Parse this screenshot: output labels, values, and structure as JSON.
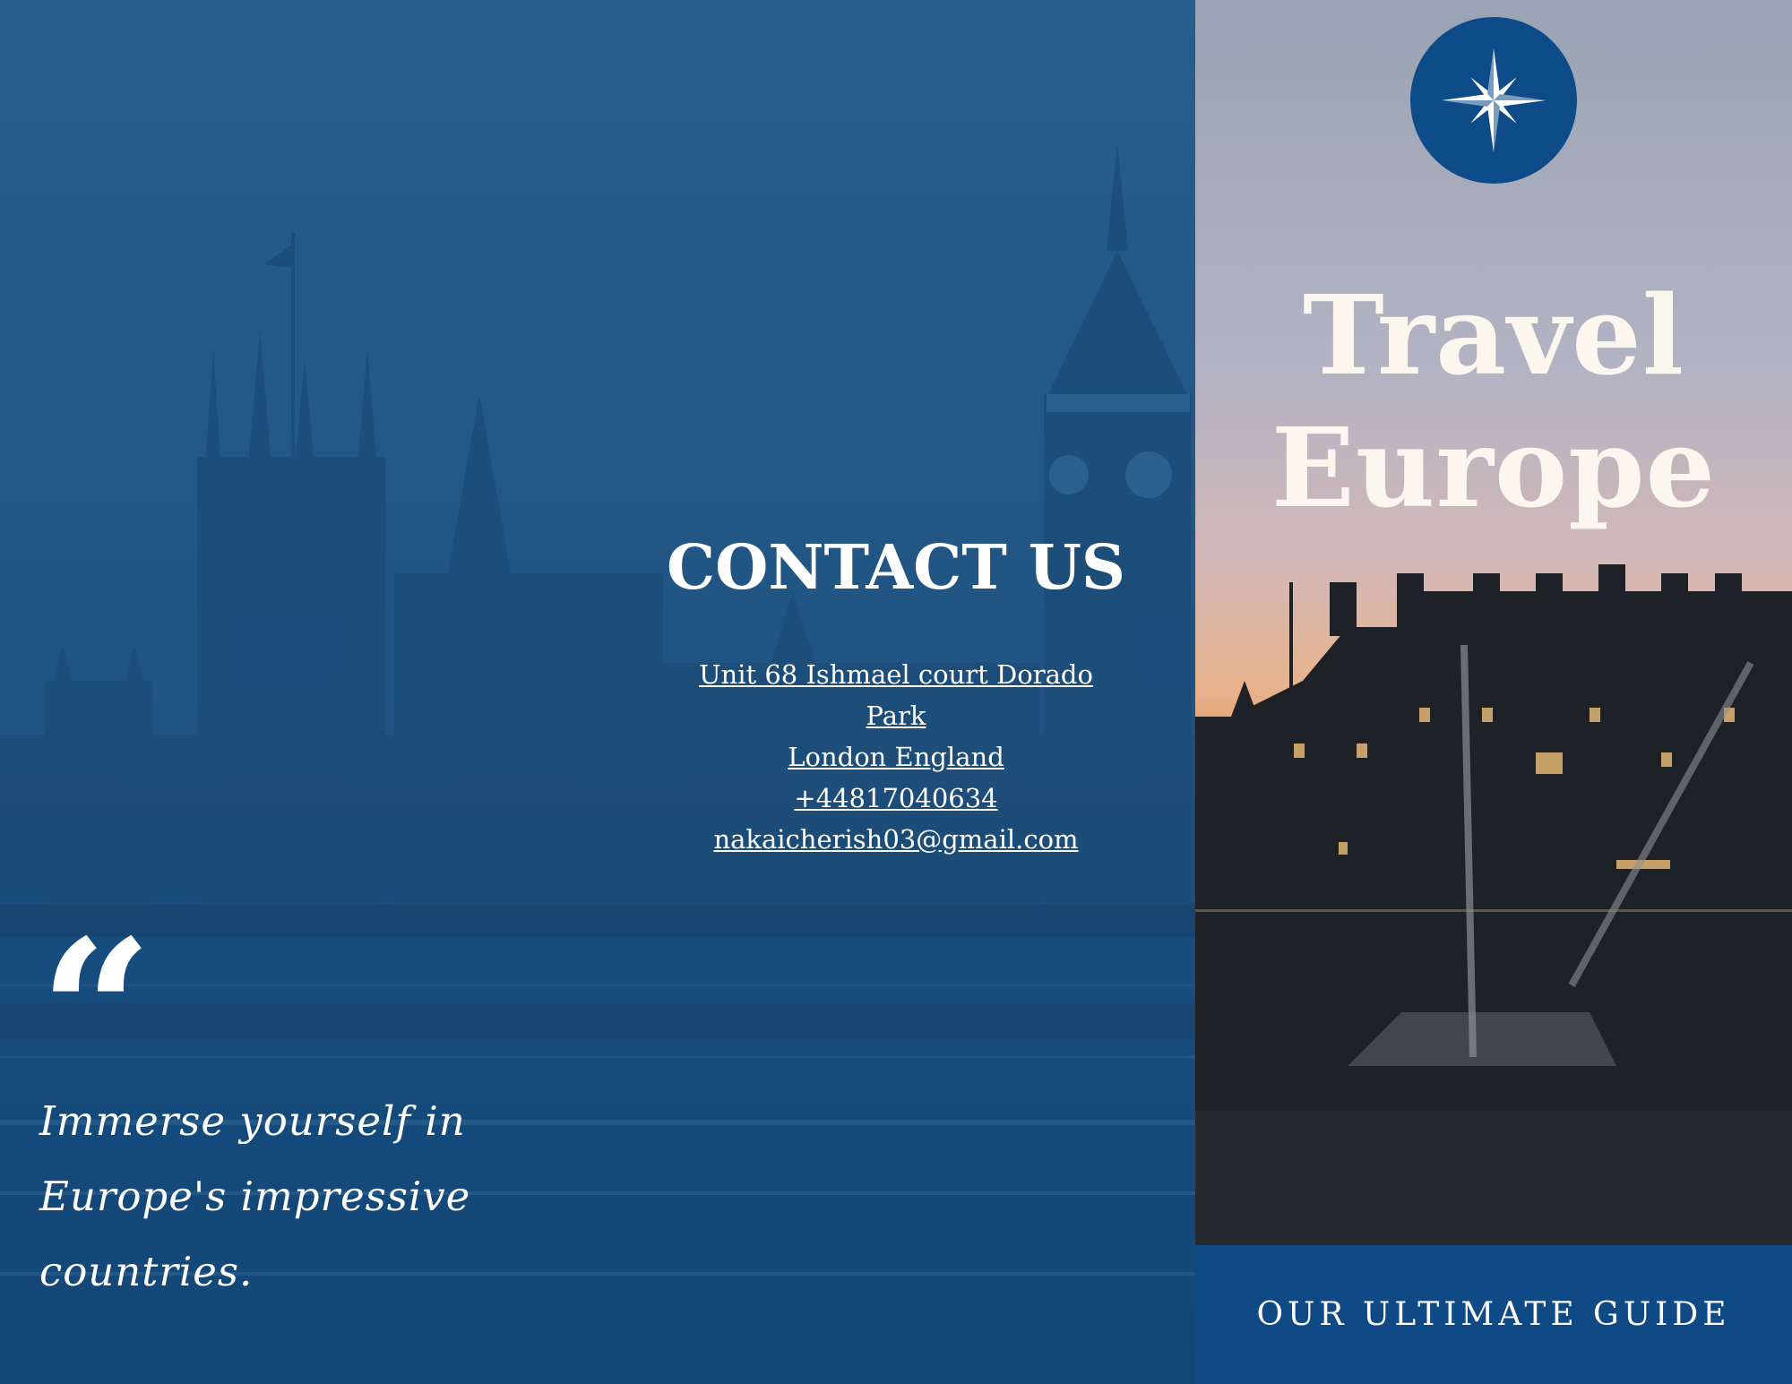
{
  "cover": {
    "title_line1": "Travel",
    "title_line2": "Europe",
    "guide_label": "OUR ULTIMATE GUIDE",
    "logo_icon": "compass-star-icon"
  },
  "contact": {
    "heading": "CONTACT US",
    "address_line1": "Unit 68 Ishmael court Dorado",
    "address_line2": "Park ",
    "address_line3": "London England",
    "phone": "+44817040634",
    "email": "nakaicherish03@gmail.com"
  },
  "quote": {
    "mark": "“",
    "text": "Immerse yourself in Europe's impressive countries."
  },
  "colors": {
    "overlay_blue": "#1f5282",
    "accent_blue": "#0f4a86",
    "title_cream": "#fbf7ee"
  }
}
